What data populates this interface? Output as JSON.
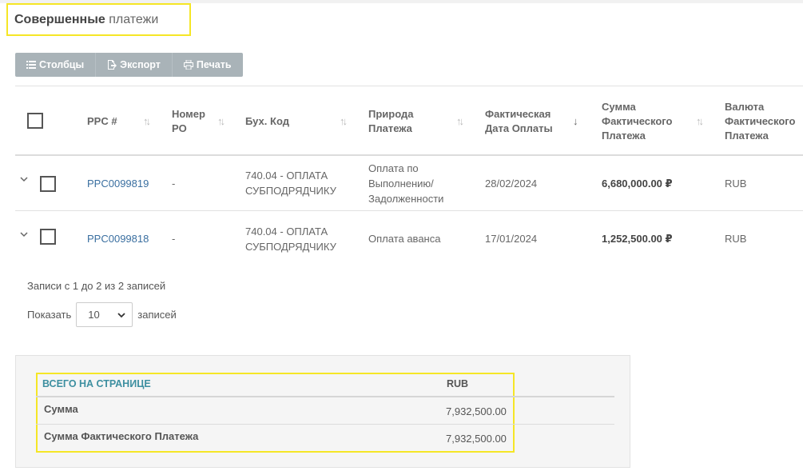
{
  "header": {
    "title_bold": "Совершенные",
    "title_rest": "платежи"
  },
  "toolbar": {
    "columns_label": "Столбцы",
    "export_label": "Экспорт",
    "print_label": "Печать"
  },
  "table": {
    "columns": [
      "PPC #",
      "Номер PO",
      "Бух. Код",
      "Природа Платежа",
      "Фактическая Дата Оплаты",
      "Сумма Фактического Платежа",
      "Валюта Фактического Платежа"
    ],
    "rows": [
      {
        "ppc": "PPC0099819",
        "po": "-",
        "code": "740.04 - ОПЛАТА СУБПОДРЯДЧИКУ",
        "nature": "Оплата по Выполнению/ Задолженности",
        "date": "28/02/2024",
        "amount": "6,680,000.00 ₽",
        "currency": "RUB"
      },
      {
        "ppc": "PPC0099818",
        "po": "-",
        "code": "740.04 - ОПЛАТА СУБПОДРЯДЧИКУ",
        "nature": "Оплата аванса",
        "date": "17/01/2024",
        "amount": "1,252,500.00 ₽",
        "currency": "RUB"
      }
    ]
  },
  "pagination": {
    "info": "Записи с 1 до 2 из 2 записей",
    "show_label": "Показать",
    "page_size": "10",
    "records_label": "записей"
  },
  "summary": {
    "heading": "ВСЕГО НА СТРАНИЦЕ",
    "currency": "RUB",
    "rows": [
      {
        "label": "Сумма",
        "value": "7,932,500.00"
      },
      {
        "label": "Сумма Фактического Платежа",
        "value": "7,932,500.00"
      }
    ]
  },
  "colors": {
    "highlight": "#f5e626",
    "link": "#3a6fa0",
    "summary_heading": "#3d8fa0",
    "toolbar": "#a9b3b8"
  }
}
